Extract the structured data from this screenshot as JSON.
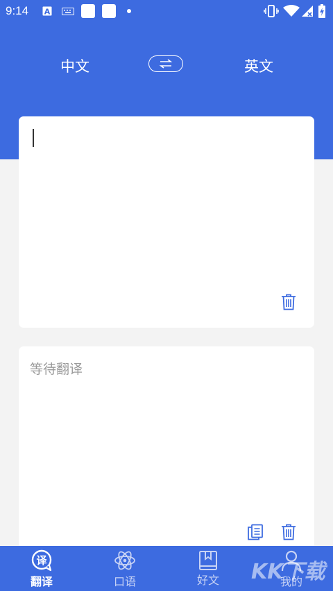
{
  "status_bar": {
    "time": "9:14"
  },
  "header": {
    "source_lang": "中文",
    "target_lang": "英文"
  },
  "input_card": {
    "text": ""
  },
  "output_card": {
    "placeholder": "等待翻译"
  },
  "bottom_nav": {
    "items": [
      {
        "label": "翻译",
        "icon": "translate-bubble-icon",
        "active": true
      },
      {
        "label": "口语",
        "icon": "atom-icon",
        "active": false
      },
      {
        "label": "好文",
        "icon": "bookmark-book-icon",
        "active": false
      },
      {
        "label": "我的",
        "icon": "user-icon",
        "active": false
      }
    ]
  },
  "watermark": "KK下载",
  "colors": {
    "primary": "#3d6be0",
    "background": "#f3f3f3",
    "card": "#ffffff",
    "placeholder": "#9a9a9a"
  }
}
